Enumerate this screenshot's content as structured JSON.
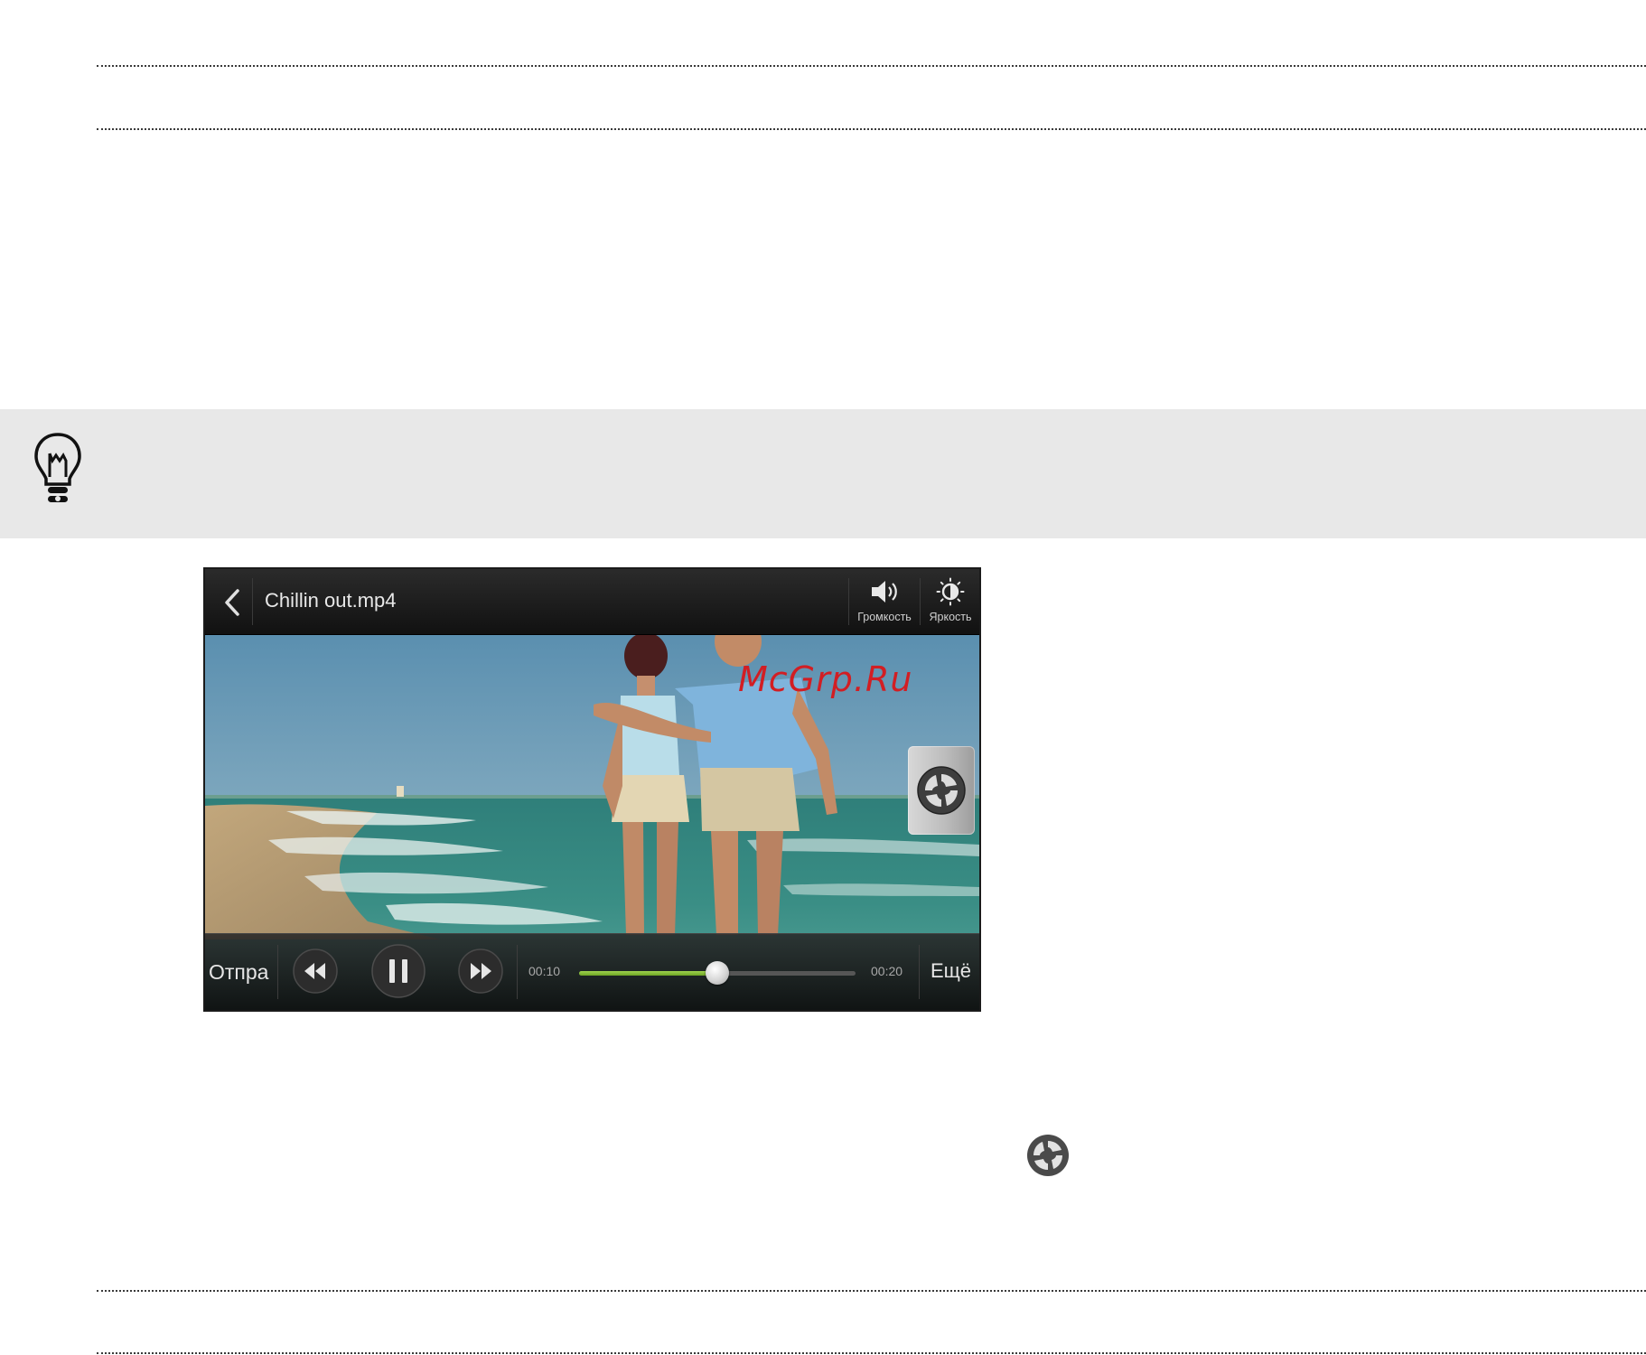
{
  "player": {
    "title": "Chillin out.mp4",
    "volume_label": "Громкость",
    "brightness_label": "Яркость",
    "send_label": "Отпра",
    "more_label": "Ещё",
    "time_elapsed": "00:10",
    "time_total": "00:20",
    "progress_fraction": 0.5
  },
  "watermark": "McGrp.Ru",
  "colors": {
    "tip_background": "#e8e8e8",
    "progress_accent": "#8cc63f",
    "watermark": "#d21e23"
  },
  "icons": {
    "tip": "lightbulb-icon",
    "back": "chevron-left-icon",
    "volume": "speaker-icon",
    "brightness": "brightness-icon",
    "snapshot": "camera-shutter-icon",
    "rewind": "rewind-icon",
    "pause": "pause-icon",
    "forward": "fast-forward-icon"
  }
}
